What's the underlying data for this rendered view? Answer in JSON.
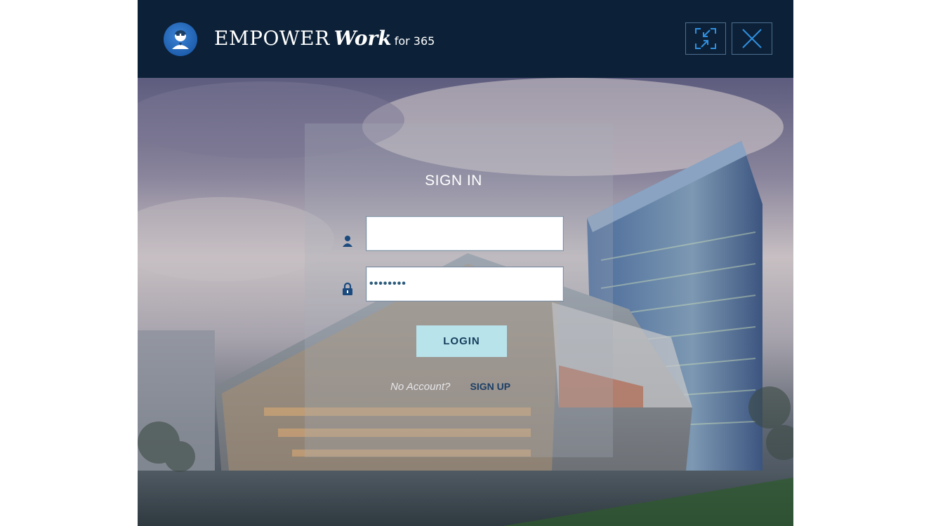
{
  "window": {
    "brand": {
      "name": "EMPOWER",
      "script": "Work",
      "suffix": "for 365"
    },
    "controls": {
      "restore_icon": "restore-down-icon",
      "close_icon": "close-icon"
    }
  },
  "login": {
    "title": "SIGN IN",
    "username": {
      "value": "",
      "icon": "user-icon"
    },
    "password": {
      "value": "••••••••",
      "icon": "lock-icon"
    },
    "login_label": "LOGIN",
    "no_account_text": "No Account?",
    "signup_label": "SIGN UP"
  },
  "colors": {
    "title_bar": "#0c2138",
    "accent": "#1f5fae",
    "login_button": "#b8e3ea",
    "control_icon": "#2f8fe0"
  }
}
